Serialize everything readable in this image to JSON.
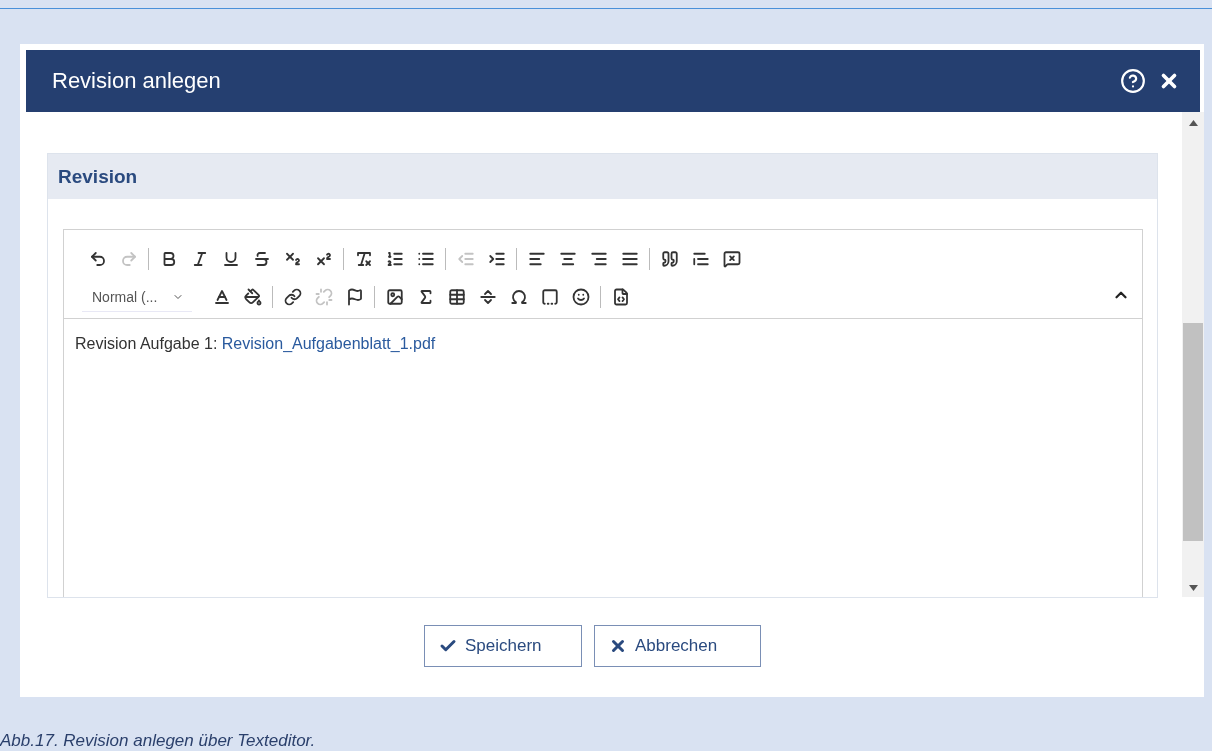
{
  "dialog": {
    "title": "Revision anlegen"
  },
  "panel": {
    "title": "Revision"
  },
  "toolbar": {
    "rows": [
      [
        {
          "kind": "undo",
          "disabled": false
        },
        {
          "kind": "redo",
          "disabled": true
        },
        {
          "kind": "sep"
        },
        {
          "kind": "bold",
          "disabled": false
        },
        {
          "kind": "italic",
          "disabled": false
        },
        {
          "kind": "underline",
          "disabled": false
        },
        {
          "kind": "strike",
          "disabled": false
        },
        {
          "kind": "subscript",
          "disabled": false
        },
        {
          "kind": "superscript",
          "disabled": false
        },
        {
          "kind": "sep"
        },
        {
          "kind": "clearformat",
          "disabled": false
        },
        {
          "kind": "numlist",
          "disabled": false
        },
        {
          "kind": "bullist",
          "disabled": false
        },
        {
          "kind": "sep"
        },
        {
          "kind": "outdent",
          "disabled": true
        },
        {
          "kind": "indent",
          "disabled": false
        },
        {
          "kind": "sep"
        },
        {
          "kind": "alignleft",
          "disabled": false
        },
        {
          "kind": "aligncenter",
          "disabled": false
        },
        {
          "kind": "alignright",
          "disabled": false
        },
        {
          "kind": "justify",
          "disabled": false
        },
        {
          "kind": "sep"
        },
        {
          "kind": "quote",
          "disabled": false
        },
        {
          "kind": "splitquote",
          "disabled": false
        },
        {
          "kind": "removequote",
          "disabled": false
        }
      ],
      [
        {
          "kind": "format",
          "label": "Normal (..."
        },
        {
          "kind": "textcolor",
          "disabled": false
        },
        {
          "kind": "bgcolor",
          "disabled": false
        },
        {
          "kind": "sep"
        },
        {
          "kind": "link",
          "disabled": false
        },
        {
          "kind": "unlink",
          "disabled": true
        },
        {
          "kind": "anchor",
          "disabled": false
        },
        {
          "kind": "sep"
        },
        {
          "kind": "image",
          "disabled": false
        },
        {
          "kind": "formula",
          "disabled": false
        },
        {
          "kind": "table",
          "disabled": false
        },
        {
          "kind": "hline",
          "disabled": false
        },
        {
          "kind": "specialchar",
          "disabled": false
        },
        {
          "kind": "pagebreak",
          "disabled": false
        },
        {
          "kind": "emoji",
          "disabled": false
        },
        {
          "kind": "sep"
        },
        {
          "kind": "source",
          "disabled": false
        }
      ]
    ]
  },
  "content": {
    "text": "Revision Aufgabe 1: ",
    "link": "Revision_Aufgabenblatt_1.pdf"
  },
  "buttons": [
    {
      "kind": "save",
      "label": "Speichern"
    },
    {
      "kind": "cancel",
      "label": "Abbrechen"
    }
  ],
  "caption": "Abb.17. Revision anlegen über Texteditor."
}
